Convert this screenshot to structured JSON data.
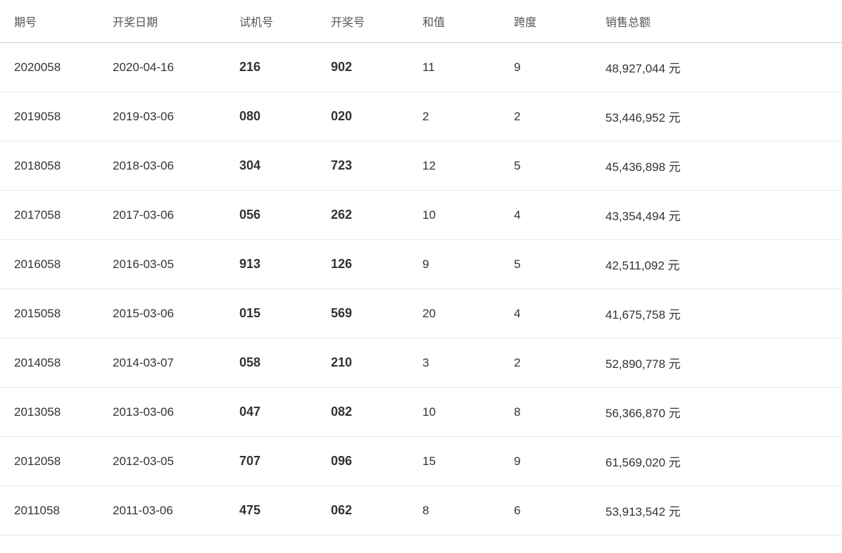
{
  "table": {
    "headers": [
      "期号",
      "开奖日期",
      "试机号",
      "开奖号",
      "和值",
      "跨度",
      "销售总额"
    ],
    "rows": [
      {
        "period": "2020058",
        "date": "2020-04-16",
        "trial": "216",
        "winning": "902",
        "sum": "11",
        "span": "9",
        "sales": "48,927,044 元"
      },
      {
        "period": "2019058",
        "date": "2019-03-06",
        "trial": "080",
        "winning": "020",
        "sum": "2",
        "span": "2",
        "sales": "53,446,952 元"
      },
      {
        "period": "2018058",
        "date": "2018-03-06",
        "trial": "304",
        "winning": "723",
        "sum": "12",
        "span": "5",
        "sales": "45,436,898 元"
      },
      {
        "period": "2017058",
        "date": "2017-03-06",
        "trial": "056",
        "winning": "262",
        "sum": "10",
        "span": "4",
        "sales": "43,354,494 元"
      },
      {
        "period": "2016058",
        "date": "2016-03-05",
        "trial": "913",
        "winning": "126",
        "sum": "9",
        "span": "5",
        "sales": "42,511,092 元"
      },
      {
        "period": "2015058",
        "date": "2015-03-06",
        "trial": "015",
        "winning": "569",
        "sum": "20",
        "span": "4",
        "sales": "41,675,758 元"
      },
      {
        "period": "2014058",
        "date": "2014-03-07",
        "trial": "058",
        "winning": "210",
        "sum": "3",
        "span": "2",
        "sales": "52,890,778 元"
      },
      {
        "period": "2013058",
        "date": "2013-03-06",
        "trial": "047",
        "winning": "082",
        "sum": "10",
        "span": "8",
        "sales": "56,366,870 元"
      },
      {
        "period": "2012058",
        "date": "2012-03-05",
        "trial": "707",
        "winning": "096",
        "sum": "15",
        "span": "9",
        "sales": "61,569,020 元"
      },
      {
        "period": "2011058",
        "date": "2011-03-06",
        "trial": "475",
        "winning": "062",
        "sum": "8",
        "span": "6",
        "sales": "53,913,542 元"
      }
    ]
  }
}
